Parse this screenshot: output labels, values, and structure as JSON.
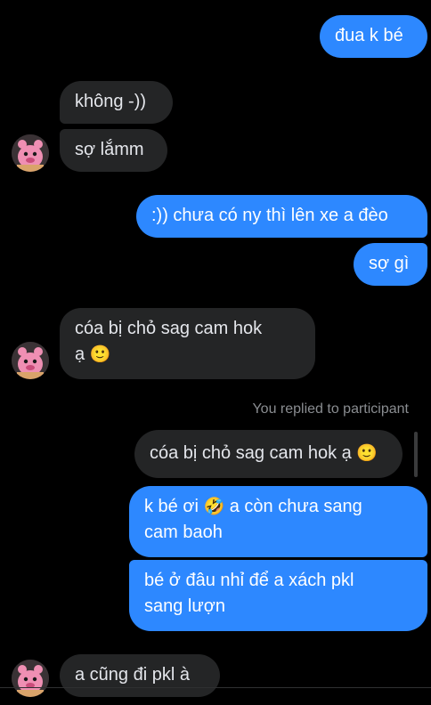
{
  "messages": [
    {
      "side": "out",
      "text": "đua k bé"
    },
    {
      "side": "in",
      "text": "không -))"
    },
    {
      "side": "in",
      "text": "sợ lắmm"
    },
    {
      "side": "out",
      "text": ":)) chưa có ny thì lên xe a đèo"
    },
    {
      "side": "out",
      "text": "sợ gì"
    },
    {
      "side": "in",
      "line1": "cóa bị chỏ sag cam hok",
      "line2": "ạ",
      "emoji": "🙂"
    },
    {
      "side": "out",
      "line1": "k bé ơi",
      "emoji": "🤣",
      "line1_rest": "a còn chưa sang",
      "line2": "cam baoh"
    },
    {
      "side": "out",
      "line1": "bé ở đâu nhỉ để a xách pkl",
      "line2": "sang lượn"
    },
    {
      "side": "in",
      "text": "a cũng đi pkl à"
    }
  ],
  "reply": {
    "note": "You replied to participant",
    "quoted_text": "cóa bị chỏ sag cam hok ạ",
    "quoted_emoji": "🙂"
  },
  "colors": {
    "background": "#000000",
    "incoming_bubble": "#242526",
    "outgoing_bubble": "#2d88ff",
    "meta_text": "#8a8d91"
  }
}
